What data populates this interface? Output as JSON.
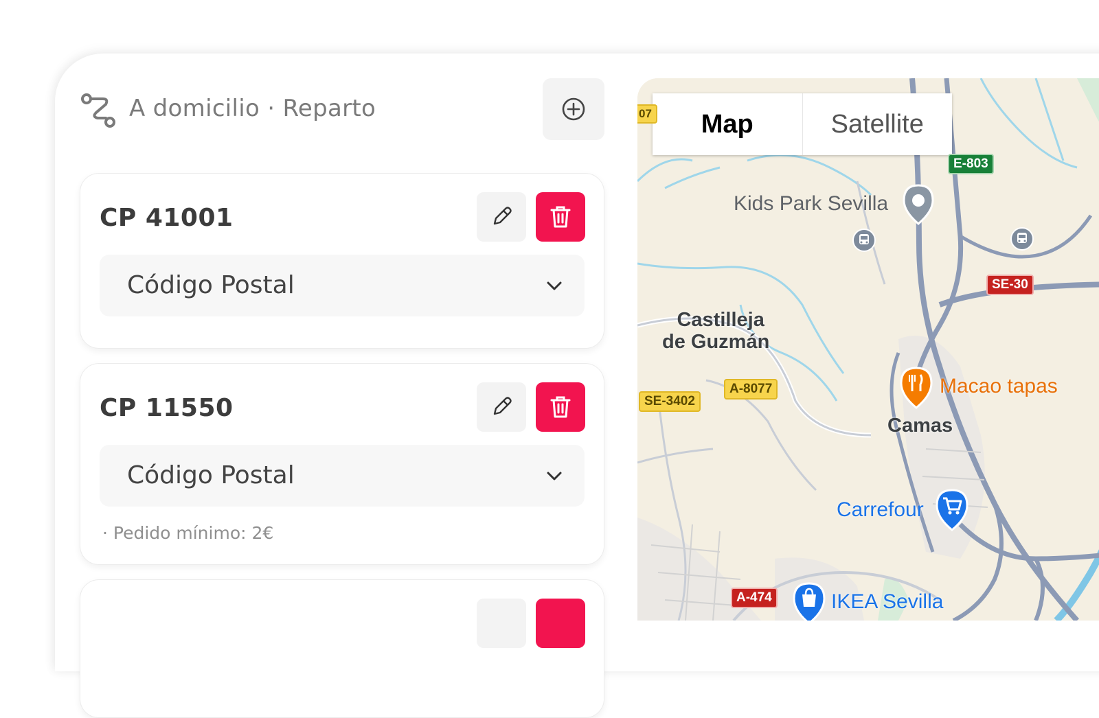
{
  "header": {
    "title": "A domicilio · Reparto"
  },
  "zones": [
    {
      "title": "CP 41001",
      "select_value": "Código Postal",
      "note": ""
    },
    {
      "title": "CP 11550",
      "select_value": "Código Postal",
      "note": "· Pedido mínimo: 2€"
    }
  ],
  "map": {
    "tabs": {
      "map": "Map",
      "satellite": "Satellite"
    },
    "places": {
      "kids_park": "Kids Park Sevilla",
      "castilleja_1": "Castilleja",
      "castilleja_2": "de Guzmán",
      "macao": "Macao tapas",
      "camas": "Camas",
      "carrefour": "Carrefour",
      "ikea": "IKEA Sevilla",
      "edge": "07"
    },
    "roads": {
      "e803": "E-803",
      "se30": "SE-30",
      "a8077": "A-8077",
      "se3402": "SE-3402",
      "a474": "A-474"
    }
  },
  "colors": {
    "accent_red": "#f2144f",
    "road_green": "#188038",
    "road_red": "#c5221f",
    "road_yellow": "#f7d44c",
    "poi_orange": "#f57c00",
    "poi_blue": "#1a73e8"
  }
}
